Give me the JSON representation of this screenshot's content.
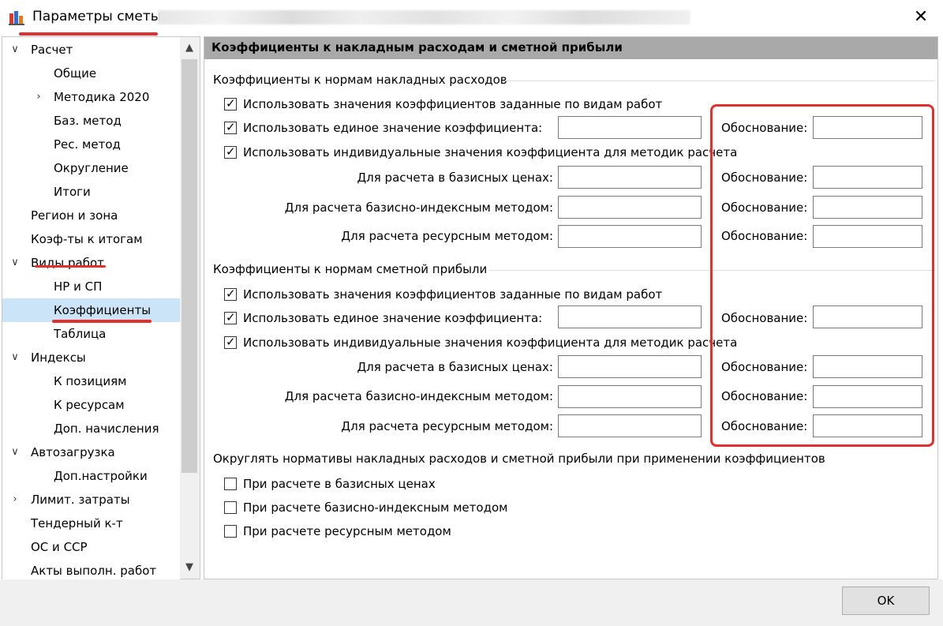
{
  "window": {
    "title": "Параметры сметы -",
    "close_label": "✕"
  },
  "tree": {
    "scroll_up": "▲",
    "scroll_down": "▼",
    "items": [
      {
        "label": "Расчет",
        "arrow": "expanded"
      },
      {
        "label": "Общие"
      },
      {
        "label": "Методика 2020",
        "arrow": "collapsed"
      },
      {
        "label": "Баз. метод"
      },
      {
        "label": "Рес. метод"
      },
      {
        "label": "Округление"
      },
      {
        "label": "Итоги"
      },
      {
        "label": "Регион и зона"
      },
      {
        "label": "Коэф-ты к итогам"
      },
      {
        "label": "Виды работ",
        "arrow": "expanded"
      },
      {
        "label": "НР и СП"
      },
      {
        "label": "Коэффициенты",
        "selected": true
      },
      {
        "label": "Таблица"
      },
      {
        "label": "Индексы",
        "arrow": "expanded"
      },
      {
        "label": "К позициям"
      },
      {
        "label": "К ресурсам"
      },
      {
        "label": "Доп. начисления"
      },
      {
        "label": "Автозагрузка",
        "arrow": "expanded"
      },
      {
        "label": "Доп.настройки"
      },
      {
        "label": "Лимит. затраты",
        "arrow": "collapsed"
      },
      {
        "label": "Тендерный к-т"
      },
      {
        "label": "ОС и ССР"
      },
      {
        "label": "Акты выполн. работ"
      }
    ]
  },
  "panel": {
    "title": "Коэффициенты к накладным расходам и сметной прибыли",
    "overhead": {
      "group_title": "Коэффициенты к нормам накладных расходов",
      "cb_by_work_type": "Использовать значения коэффициентов заданные по видам работ",
      "cb_single": "Использовать единое значение коэффициента:",
      "cb_individual": "Использовать индивидуальные значения коэффициента для методик расчета",
      "base_prices": "Для расчета в базисных ценах:",
      "base_index": "Для расчета базисно-индексным методом:",
      "resource": "Для расчета ресурсным методом:",
      "justification": "Обоснование:"
    },
    "profit": {
      "group_title": "Коэффициенты к нормам сметной прибыли",
      "cb_by_work_type": "Использовать значения коэффициентов заданные по видам работ",
      "cb_single": "Использовать единое значение коэффициента:",
      "cb_individual": "Использовать индивидуальные значения коэффициента для методик расчета",
      "base_prices": "Для расчета в базисных ценах:",
      "base_index": "Для расчета базисно-индексным методом:",
      "resource": "Для расчета ресурсным методом:",
      "justification": "Обоснование:"
    },
    "rounding": {
      "group_title": "Округлять нормативы накладных расходов и сметной прибыли при применении коэффициентов",
      "cb_base_prices": "При расчете в базисных ценах",
      "cb_base_index": "При расчете базисно-индексным методом",
      "cb_resource": "При расчете ресурсным методом"
    }
  },
  "footer": {
    "ok_label": "OK"
  },
  "check_mark": "✓",
  "colors": {
    "highlight": "#e03030",
    "selection": "#cce4f7",
    "header_bar": "#a9a9a9"
  }
}
